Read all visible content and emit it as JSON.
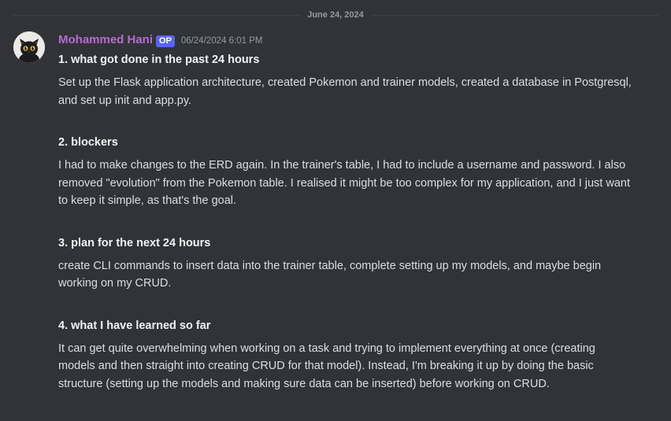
{
  "divider": {
    "date": "June 24, 2024"
  },
  "message": {
    "avatar": "black-cat-avatar",
    "author": "Mohammed Hani",
    "badge": "OP",
    "timestamp": "06/24/2024 6:01 PM",
    "sections": [
      {
        "heading": "1. what got done in the past 24 hours",
        "body": "Set up the Flask application architecture, created Pokemon and trainer models, created a database in Postgresql, and set up init and app.py."
      },
      {
        "heading": "2. blockers",
        "body": "I had to make changes to the ERD again. In the trainer's table, I had to include a username and password.  I also removed \"evolution\" from the Pokemon table. I realised it might be too complex for my application, and I just want to keep it simple, as that's the goal."
      },
      {
        "heading": "3. plan for the next 24 hours",
        "body": "create CLI commands to insert data into the trainer table, complete setting up my models, and maybe begin working on my CRUD."
      },
      {
        "heading": "4. what I have learned so far",
        "body": "It can get quite overwhelming when working on a task and trying to implement everything at once (creating models and then straight into creating CRUD for that model). Instead, I'm breaking it up by doing the basic structure (setting up the models and making sure data can be inserted) before working on CRUD."
      }
    ]
  },
  "colors": {
    "background": "#313338",
    "username": "#b76bd0",
    "badge": "#5865f2",
    "text": "#dbdee1",
    "muted": "#949ba4"
  }
}
